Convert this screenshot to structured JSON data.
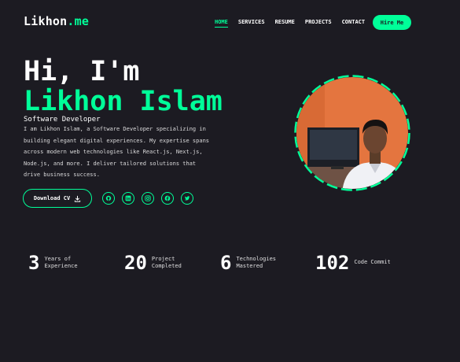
{
  "logo": {
    "text": "Likhon",
    "accent": ".me"
  },
  "nav": {
    "items": [
      "HOME",
      "SERVICES",
      "RESUME",
      "PROJECTS",
      "CONTACT"
    ],
    "active": "HOME",
    "cta": "Hire Me"
  },
  "hero": {
    "greeting": "Hi, I'm",
    "name": "Likhon Islam",
    "role": "Software Developer",
    "bio": "I am Likhon Islam, a Software Developer specializing in building elegant digital experiences. My expertise spans across modern web technologies like React.js, Next.js, Node.js, and more. I deliver tailored solutions that drive business success.",
    "download_label": "Download CV",
    "download_icon": "download-icon",
    "socials": [
      "github-icon",
      "linkedin-icon",
      "instagram-icon",
      "facebook-icon",
      "twitter-icon"
    ]
  },
  "stats": [
    {
      "value": "3",
      "label": "Years of\nExperience"
    },
    {
      "value": "20",
      "label": "Project\nCompleted"
    },
    {
      "value": "6",
      "label": "Technologies\nMastered"
    },
    {
      "value": "102",
      "label": "Code Commit"
    }
  ],
  "colors": {
    "accent": "#00ff99",
    "background": "#1c1b22",
    "text": "#ffffff"
  }
}
